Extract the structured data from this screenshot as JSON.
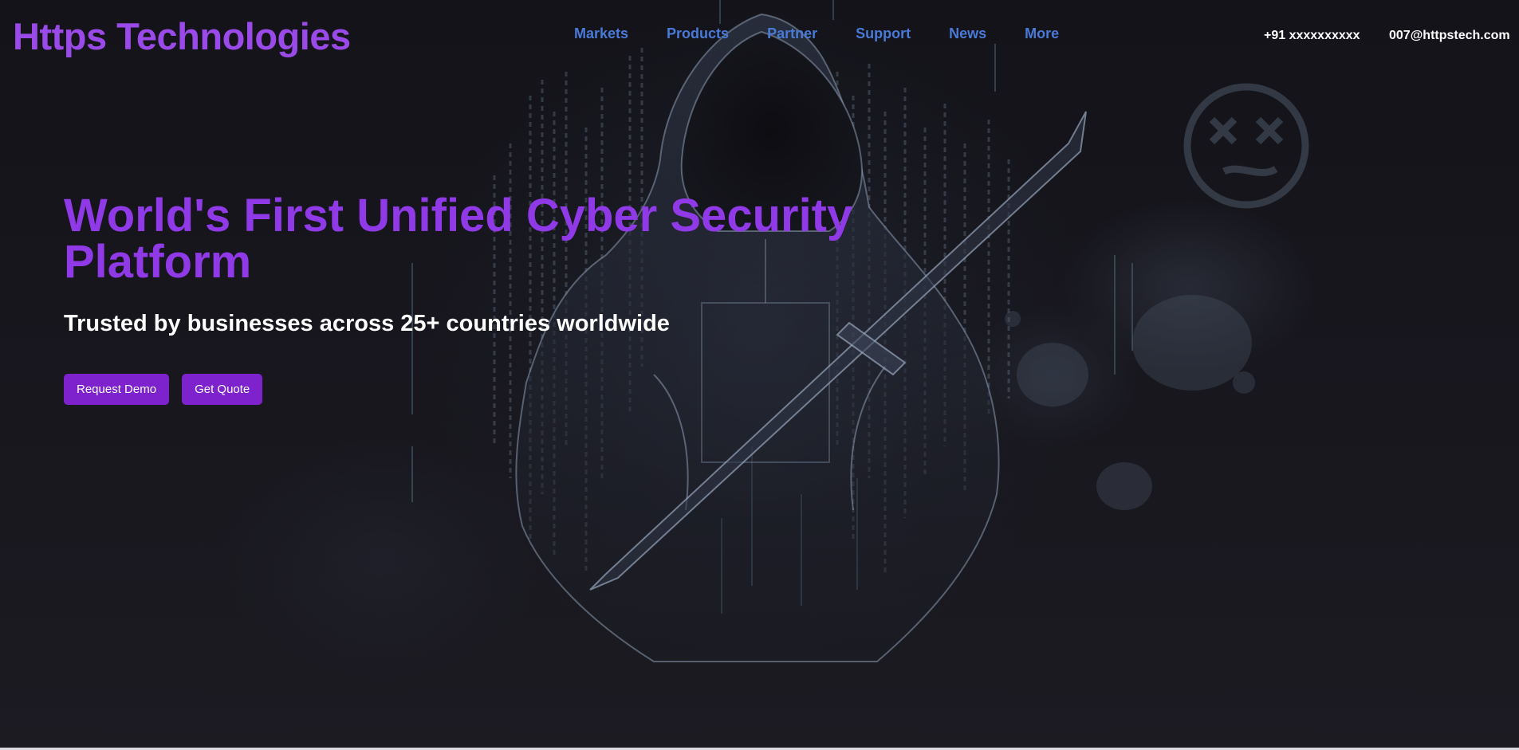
{
  "brand": {
    "name": "Https Technologies"
  },
  "nav": {
    "items": [
      {
        "label": "Markets"
      },
      {
        "label": "Products"
      },
      {
        "label": "Partner"
      },
      {
        "label": "Support"
      },
      {
        "label": "News"
      },
      {
        "label": "More"
      }
    ]
  },
  "contact": {
    "phone": "+91 xxxxxxxxxx",
    "email": "007@httpstech.com"
  },
  "hero": {
    "title": "World's First Unified Cyber Security Platform",
    "subtitle": "Trusted by businesses across 25+ countries worldwide",
    "primary_button": "Request Demo",
    "secondary_button": "Get Quote"
  },
  "colors": {
    "brand_purple": "#9a4ae8",
    "title_purple": "#8f3ae6",
    "button_purple": "#7e22ce",
    "nav_blue": "#4a7ad8",
    "background": "#17161d"
  },
  "background_image": {
    "subject": "hooded-hacker-with-blade",
    "decoration": "skull-graffiti-icon"
  }
}
